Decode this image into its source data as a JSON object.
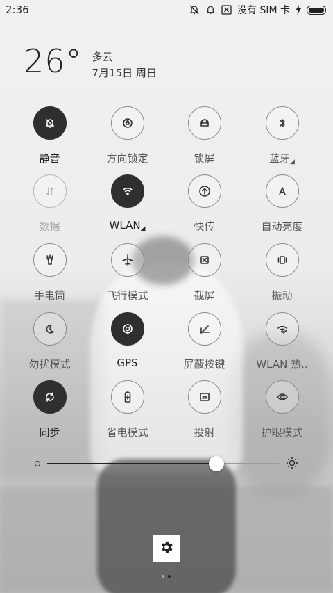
{
  "status_bar": {
    "time": "2:36",
    "carrier": "没有 SIM 卡"
  },
  "weather": {
    "temperature": "26°",
    "condition": "多云",
    "date": "7月15日 周日"
  },
  "tiles": [
    {
      "label": "静音",
      "icon": "bell-off-icon",
      "state": "on",
      "has_menu": false
    },
    {
      "label": "方向锁定",
      "icon": "rotation-lock-icon",
      "state": "off",
      "has_menu": false
    },
    {
      "label": "锁屏",
      "icon": "lock-icon",
      "state": "off",
      "has_menu": false
    },
    {
      "label": "蓝牙",
      "icon": "bluetooth-icon",
      "state": "off",
      "has_menu": true
    },
    {
      "label": "数据",
      "icon": "mobile-data-icon",
      "state": "disabled",
      "has_menu": false
    },
    {
      "label": "WLAN",
      "icon": "wifi-icon",
      "state": "on",
      "has_menu": true
    },
    {
      "label": "快传",
      "icon": "fast-transfer-icon",
      "state": "off",
      "has_menu": false
    },
    {
      "label": "自动亮度",
      "icon": "auto-brightness-icon",
      "state": "off",
      "has_menu": false
    },
    {
      "label": "手电筒",
      "icon": "flashlight-icon",
      "state": "off",
      "has_menu": false
    },
    {
      "label": "飞行模式",
      "icon": "airplane-icon",
      "state": "off",
      "has_menu": false
    },
    {
      "label": "截屏",
      "icon": "screenshot-icon",
      "state": "off",
      "has_menu": false
    },
    {
      "label": "振动",
      "icon": "vibrate-icon",
      "state": "off",
      "has_menu": false
    },
    {
      "label": "勿扰模式",
      "icon": "moon-icon",
      "state": "off",
      "has_menu": false
    },
    {
      "label": "GPS",
      "icon": "gps-icon",
      "state": "on",
      "has_menu": false
    },
    {
      "label": "屏蔽按键",
      "icon": "block-keys-icon",
      "state": "off",
      "has_menu": false
    },
    {
      "label": "WLAN 热..",
      "icon": "hotspot-icon",
      "state": "off",
      "has_menu": false
    },
    {
      "label": "同步",
      "icon": "sync-icon",
      "state": "on",
      "has_menu": false
    },
    {
      "label": "省电模式",
      "icon": "battery-saver-icon",
      "state": "off",
      "has_menu": false
    },
    {
      "label": "投射",
      "icon": "cast-icon",
      "state": "off",
      "has_menu": false
    },
    {
      "label": "护眼模式",
      "icon": "eye-icon",
      "state": "off",
      "has_menu": false
    }
  ],
  "brightness": {
    "level": 0.73
  },
  "pager": {
    "pages": 2,
    "current": 2
  },
  "colors": {
    "tile_on": "#2f2f2f",
    "tile_off_border": "#8a8a8a",
    "text": "#3a3a3a"
  }
}
